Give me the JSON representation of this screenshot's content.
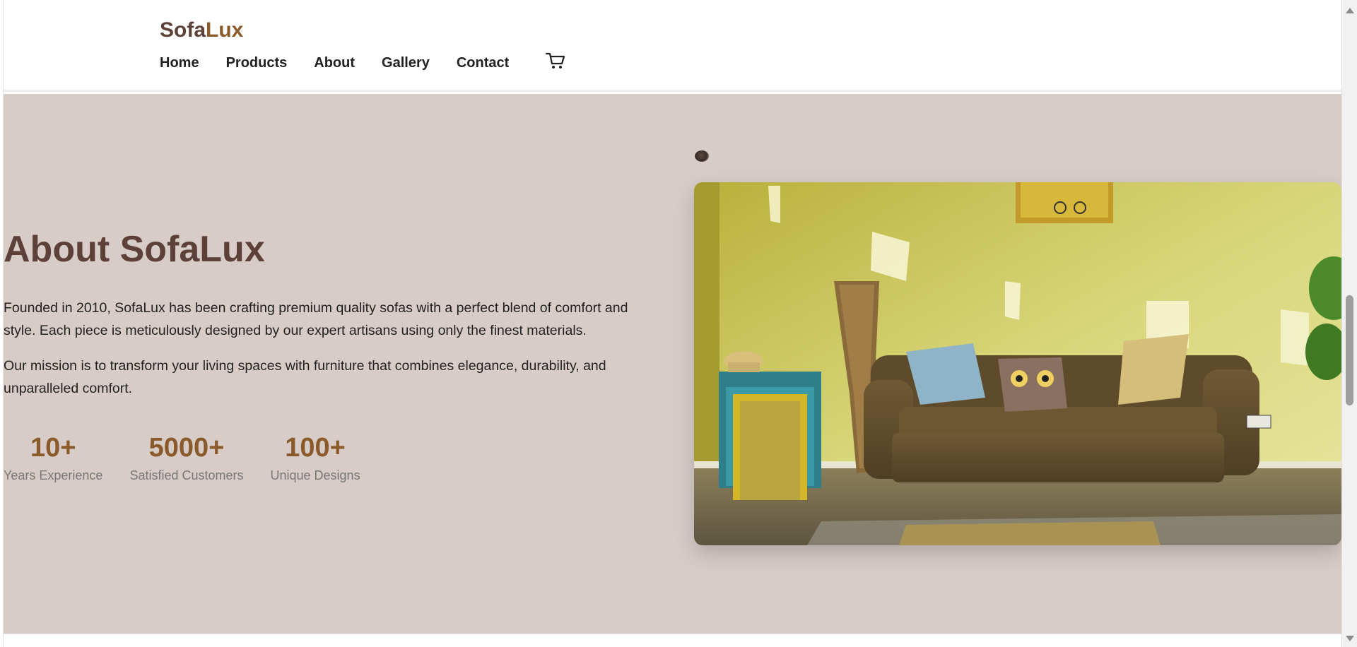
{
  "header": {
    "logo_part1": "Sofa",
    "logo_part2": "Lux",
    "nav": [
      "Home",
      "Products",
      "About",
      "Gallery",
      "Contact"
    ],
    "cart_icon": "cart-icon"
  },
  "about": {
    "title": "About SofaLux",
    "paragraph1": "Founded in 2010, SofaLux has been crafting premium quality sofas with a perfect blend of comfort and style. Each piece is meticulously designed by our expert artisans using only the finest materials.",
    "paragraph2": "Our mission is to transform your living spaces with furniture that combines elegance, durability, and unparalleled comfort.",
    "stats": [
      {
        "value": "10+",
        "label": "Years Experience"
      },
      {
        "value": "5000+",
        "label": "Satisfied Customers"
      },
      {
        "value": "100+",
        "label": "Unique Designs"
      }
    ],
    "image": "living-room-sofa-photo"
  },
  "colors": {
    "brand_dark": "#5d4037",
    "brand_accent": "#8b5a2b",
    "section_bg": "#d7ccc8"
  }
}
